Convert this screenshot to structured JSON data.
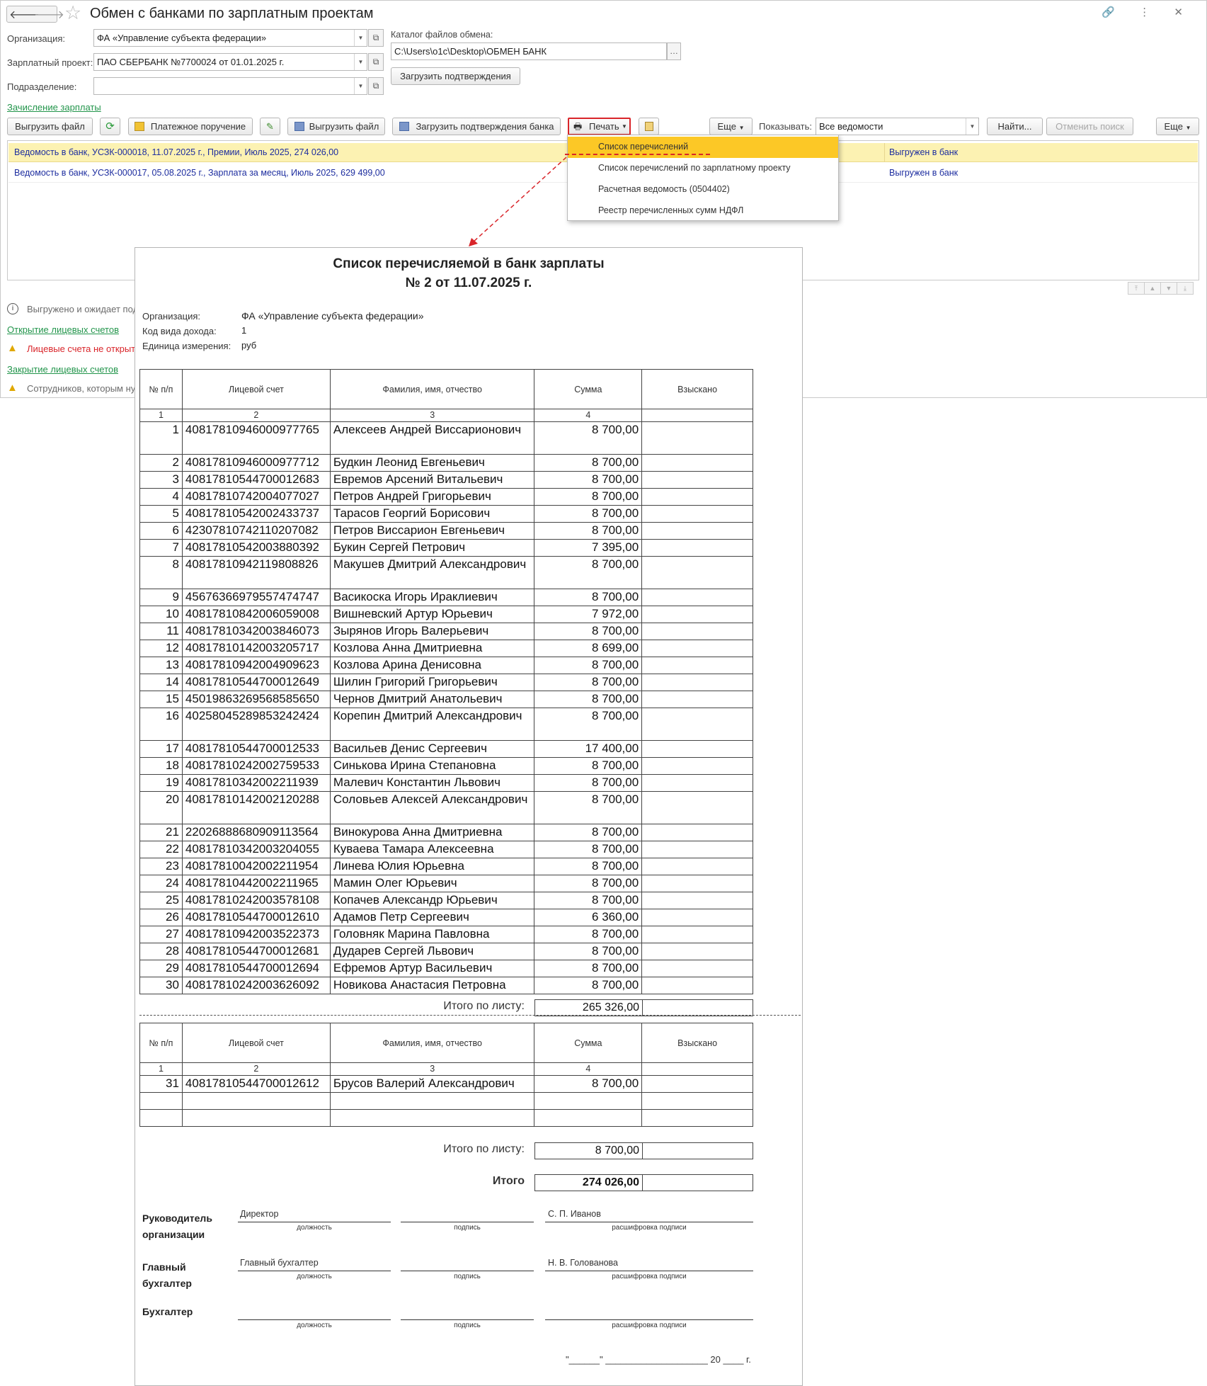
{
  "app": {
    "title": "Обмен с банками по зарплатным проектам",
    "nav_back": "🡐",
    "nav_fwd": "🡒",
    "win_icons": "🔗 ⋮ ✕",
    "org_label": "Организация:",
    "org_value": "ФА «Управление субъекта федерации»",
    "project_label": "Зарплатный проект:",
    "project_value": "ПАО СБЕРБАНК №7700024 от 01.01.2025 г.",
    "dept_label": "Подразделение:",
    "dept_value": "",
    "catalog_label": "Каталог файлов обмена:",
    "catalog_value": "C:\\Users\\o1c\\Desktop\\ОБМЕН БАНК",
    "load_confirm_btn": "Загрузить подтверждения",
    "salary_link": "Зачисление зарплаты"
  },
  "toolbar": {
    "upload_file": "Выгрузить файл",
    "payment_order": "Платежное поручение",
    "upload_file2": "Выгрузить файл",
    "load_bank_confirm": "Загрузить подтверждения банка",
    "print": "Печать",
    "more": "Еще",
    "show_label": "Показывать:",
    "show_value": "Все ведомости",
    "find": "Найти...",
    "cancel_search": "Отменить поиск",
    "more2": "Еще"
  },
  "list": {
    "rows": [
      {
        "text": "Ведомость в банк, УСЗК-000018, 11.07.2025 г., Премии, Июль 2025, 274 026,00",
        "status": "Выгружен в банк"
      },
      {
        "text": "Ведомость в банк, УСЗК-000017, 05.08.2025 г., Зарплата за месяц, Июль 2025, 629 499,00",
        "status": "Выгружен в банк"
      }
    ]
  },
  "print_menu": {
    "items": [
      "Список перечислений",
      "Список перечислений по зарплатному проекту",
      "Расчетная ведомость (0504402)",
      "Реестр перечисленных сумм НДФЛ"
    ]
  },
  "messages": {
    "m1": "Выгружено и ожидает под",
    "link_open": "Открытие лицевых счетов",
    "m2": "Лицевые счета не открыт",
    "link_close": "Закрытие лицевых счетов",
    "m3": "Сотрудников, которым ну"
  },
  "doc": {
    "title1": "Список перечисляемой в банк зарплаты",
    "title2": "№  2 от 11.07.2025 г.",
    "org_label": "Организация:",
    "org_value": "ФА «Управление субъекта федерации»",
    "income_label": "Код вида дохода:",
    "income_value": "1",
    "unit_label": "Единица измерения:",
    "unit_value": "руб",
    "headers": [
      "№ п/п",
      "Лицевой счет",
      "Фамилия, имя, отчество",
      "Сумма",
      "Взыскано"
    ],
    "col_numbers": [
      "1",
      "2",
      "3",
      "4",
      ""
    ],
    "rows": [
      {
        "n": "1",
        "acc": "40817810946000977765",
        "name": "Алексеев Андрей Виссарионович",
        "sum": "8 700,00",
        "tall": true
      },
      {
        "n": "2",
        "acc": "40817810946000977712",
        "name": "Будкин Леонид Евгеньевич",
        "sum": "8 700,00"
      },
      {
        "n": "3",
        "acc": "40817810544700012683",
        "name": "Евремов Арсений Витальевич",
        "sum": "8 700,00"
      },
      {
        "n": "4",
        "acc": "40817810742004077027",
        "name": "Петров Андрей Григорьевич",
        "sum": "8 700,00"
      },
      {
        "n": "5",
        "acc": "40817810542002433737",
        "name": "Тарасов Георгий Борисович",
        "sum": "8 700,00"
      },
      {
        "n": "6",
        "acc": "42307810742110207082",
        "name": "Петров Виссарион Евгеньевич",
        "sum": "8 700,00"
      },
      {
        "n": "7",
        "acc": "40817810542003880392",
        "name": "Букин Сергей Петрович",
        "sum": "7 395,00"
      },
      {
        "n": "8",
        "acc": "40817810942119808826",
        "name": "Макушев Дмитрий Александрович",
        "sum": "8 700,00",
        "tall": true
      },
      {
        "n": "9",
        "acc": "45676366979557474747",
        "name": "Васикоска Игорь Ираклиевич",
        "sum": "8 700,00"
      },
      {
        "n": "10",
        "acc": "40817810842006059008",
        "name": "Вишневский Артур Юрьевич",
        "sum": "7 972,00"
      },
      {
        "n": "11",
        "acc": "40817810342003846073",
        "name": "Зырянов Игорь Валерьевич",
        "sum": "8 700,00"
      },
      {
        "n": "12",
        "acc": "40817810142003205717",
        "name": "Козлова Анна Дмитриевна",
        "sum": "8 699,00"
      },
      {
        "n": "13",
        "acc": "40817810942004909623",
        "name": "Козлова Арина Денисовна",
        "sum": "8 700,00"
      },
      {
        "n": "14",
        "acc": "40817810544700012649",
        "name": "Шилин Григорий Григорьевич",
        "sum": "8 700,00"
      },
      {
        "n": "15",
        "acc": "45019863269568585650",
        "name": "Чернов Дмитрий Анатольевич",
        "sum": "8 700,00"
      },
      {
        "n": "16",
        "acc": "40258045289853242424",
        "name": "Корепин Дмитрий Александрович",
        "sum": "8 700,00",
        "tall": true
      },
      {
        "n": "17",
        "acc": "40817810544700012533",
        "name": "Васильев Денис Сергеевич",
        "sum": "17 400,00"
      },
      {
        "n": "18",
        "acc": "40817810242002759533",
        "name": "Синькова Ирина Степановна",
        "sum": "8 700,00"
      },
      {
        "n": "19",
        "acc": "40817810342002211939",
        "name": "Малевич Константин Львович",
        "sum": "8 700,00"
      },
      {
        "n": "20",
        "acc": "40817810142002120288",
        "name": "Соловьев Алексей Александрович",
        "sum": "8 700,00",
        "tall": true
      },
      {
        "n": "21",
        "acc": "22026888680909113564",
        "name": "Винокурова Анна Дмитриевна",
        "sum": "8 700,00"
      },
      {
        "n": "22",
        "acc": "40817810342003204055",
        "name": "Куваева Тамара Алексеевна",
        "sum": "8 700,00"
      },
      {
        "n": "23",
        "acc": "40817810042002211954",
        "name": "Линева Юлия Юрьевна",
        "sum": "8 700,00"
      },
      {
        "n": "24",
        "acc": "40817810442002211965",
        "name": "Мамин Олег Юрьевич",
        "sum": "8 700,00"
      },
      {
        "n": "25",
        "acc": "40817810242003578108",
        "name": "Копачев Александр Юрьевич",
        "sum": "8 700,00"
      },
      {
        "n": "26",
        "acc": "40817810544700012610",
        "name": "Адамов Петр Сергеевич",
        "sum": "6 360,00"
      },
      {
        "n": "27",
        "acc": "40817810942003522373",
        "name": "Головняк Марина Павловна",
        "sum": "8 700,00"
      },
      {
        "n": "28",
        "acc": "40817810544700012681",
        "name": "Дударев Сергей Львович",
        "sum": "8 700,00"
      },
      {
        "n": "29",
        "acc": "40817810544700012694",
        "name": "Ефремов Артур Васильевич",
        "sum": "8 700,00"
      },
      {
        "n": "30",
        "acc": "40817810242003626092",
        "name": "Новикова Анастасия Петровна",
        "sum": "8 700,00"
      }
    ],
    "page_total_label": "Итого по листу:",
    "page1_total": "265 326,00",
    "rows2": [
      {
        "n": "31",
        "acc": "40817810544700012612",
        "name": "Брусов Валерий Александрович",
        "sum": "8 700,00"
      }
    ],
    "page2_total": "8 700,00",
    "grand_total_label": "Итого",
    "grand_total": "274 026,00",
    "signatures": {
      "head_role": "Руководитель организации",
      "head_position": "Директор",
      "head_name": "С. П. Иванов",
      "chief_role": "Главный бухгалтер",
      "chief_position": "Главный бухгалтер",
      "chief_name": "Н. В. Голованова",
      "acc_role": "Бухгалтер",
      "cap_position": "должность",
      "cap_sign": "подпись",
      "cap_decode": "расшифровка подписи"
    },
    "date_line": "\"______\" ____________________ 20 ____ г."
  }
}
